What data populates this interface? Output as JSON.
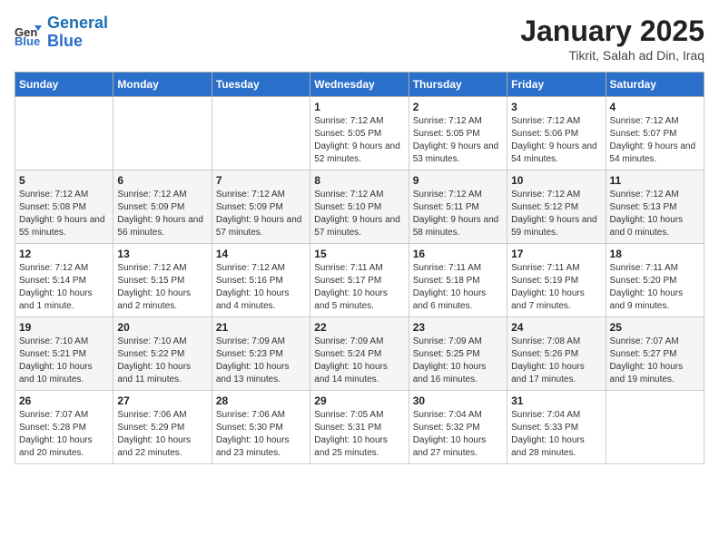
{
  "header": {
    "logo_line1": "General",
    "logo_line2": "Blue",
    "title": "January 2025",
    "subtitle": "Tikrit, Salah ad Din, Iraq"
  },
  "days_of_week": [
    "Sunday",
    "Monday",
    "Tuesday",
    "Wednesday",
    "Thursday",
    "Friday",
    "Saturday"
  ],
  "weeks": [
    [
      {
        "day": "",
        "info": ""
      },
      {
        "day": "",
        "info": ""
      },
      {
        "day": "",
        "info": ""
      },
      {
        "day": "1",
        "info": "Sunrise: 7:12 AM\nSunset: 5:05 PM\nDaylight: 9 hours and 52 minutes."
      },
      {
        "day": "2",
        "info": "Sunrise: 7:12 AM\nSunset: 5:05 PM\nDaylight: 9 hours and 53 minutes."
      },
      {
        "day": "3",
        "info": "Sunrise: 7:12 AM\nSunset: 5:06 PM\nDaylight: 9 hours and 54 minutes."
      },
      {
        "day": "4",
        "info": "Sunrise: 7:12 AM\nSunset: 5:07 PM\nDaylight: 9 hours and 54 minutes."
      }
    ],
    [
      {
        "day": "5",
        "info": "Sunrise: 7:12 AM\nSunset: 5:08 PM\nDaylight: 9 hours and 55 minutes."
      },
      {
        "day": "6",
        "info": "Sunrise: 7:12 AM\nSunset: 5:09 PM\nDaylight: 9 hours and 56 minutes."
      },
      {
        "day": "7",
        "info": "Sunrise: 7:12 AM\nSunset: 5:09 PM\nDaylight: 9 hours and 57 minutes."
      },
      {
        "day": "8",
        "info": "Sunrise: 7:12 AM\nSunset: 5:10 PM\nDaylight: 9 hours and 57 minutes."
      },
      {
        "day": "9",
        "info": "Sunrise: 7:12 AM\nSunset: 5:11 PM\nDaylight: 9 hours and 58 minutes."
      },
      {
        "day": "10",
        "info": "Sunrise: 7:12 AM\nSunset: 5:12 PM\nDaylight: 9 hours and 59 minutes."
      },
      {
        "day": "11",
        "info": "Sunrise: 7:12 AM\nSunset: 5:13 PM\nDaylight: 10 hours and 0 minutes."
      }
    ],
    [
      {
        "day": "12",
        "info": "Sunrise: 7:12 AM\nSunset: 5:14 PM\nDaylight: 10 hours and 1 minute."
      },
      {
        "day": "13",
        "info": "Sunrise: 7:12 AM\nSunset: 5:15 PM\nDaylight: 10 hours and 2 minutes."
      },
      {
        "day": "14",
        "info": "Sunrise: 7:12 AM\nSunset: 5:16 PM\nDaylight: 10 hours and 4 minutes."
      },
      {
        "day": "15",
        "info": "Sunrise: 7:11 AM\nSunset: 5:17 PM\nDaylight: 10 hours and 5 minutes."
      },
      {
        "day": "16",
        "info": "Sunrise: 7:11 AM\nSunset: 5:18 PM\nDaylight: 10 hours and 6 minutes."
      },
      {
        "day": "17",
        "info": "Sunrise: 7:11 AM\nSunset: 5:19 PM\nDaylight: 10 hours and 7 minutes."
      },
      {
        "day": "18",
        "info": "Sunrise: 7:11 AM\nSunset: 5:20 PM\nDaylight: 10 hours and 9 minutes."
      }
    ],
    [
      {
        "day": "19",
        "info": "Sunrise: 7:10 AM\nSunset: 5:21 PM\nDaylight: 10 hours and 10 minutes."
      },
      {
        "day": "20",
        "info": "Sunrise: 7:10 AM\nSunset: 5:22 PM\nDaylight: 10 hours and 11 minutes."
      },
      {
        "day": "21",
        "info": "Sunrise: 7:09 AM\nSunset: 5:23 PM\nDaylight: 10 hours and 13 minutes."
      },
      {
        "day": "22",
        "info": "Sunrise: 7:09 AM\nSunset: 5:24 PM\nDaylight: 10 hours and 14 minutes."
      },
      {
        "day": "23",
        "info": "Sunrise: 7:09 AM\nSunset: 5:25 PM\nDaylight: 10 hours and 16 minutes."
      },
      {
        "day": "24",
        "info": "Sunrise: 7:08 AM\nSunset: 5:26 PM\nDaylight: 10 hours and 17 minutes."
      },
      {
        "day": "25",
        "info": "Sunrise: 7:07 AM\nSunset: 5:27 PM\nDaylight: 10 hours and 19 minutes."
      }
    ],
    [
      {
        "day": "26",
        "info": "Sunrise: 7:07 AM\nSunset: 5:28 PM\nDaylight: 10 hours and 20 minutes."
      },
      {
        "day": "27",
        "info": "Sunrise: 7:06 AM\nSunset: 5:29 PM\nDaylight: 10 hours and 22 minutes."
      },
      {
        "day": "28",
        "info": "Sunrise: 7:06 AM\nSunset: 5:30 PM\nDaylight: 10 hours and 23 minutes."
      },
      {
        "day": "29",
        "info": "Sunrise: 7:05 AM\nSunset: 5:31 PM\nDaylight: 10 hours and 25 minutes."
      },
      {
        "day": "30",
        "info": "Sunrise: 7:04 AM\nSunset: 5:32 PM\nDaylight: 10 hours and 27 minutes."
      },
      {
        "day": "31",
        "info": "Sunrise: 7:04 AM\nSunset: 5:33 PM\nDaylight: 10 hours and 28 minutes."
      },
      {
        "day": "",
        "info": ""
      }
    ]
  ]
}
